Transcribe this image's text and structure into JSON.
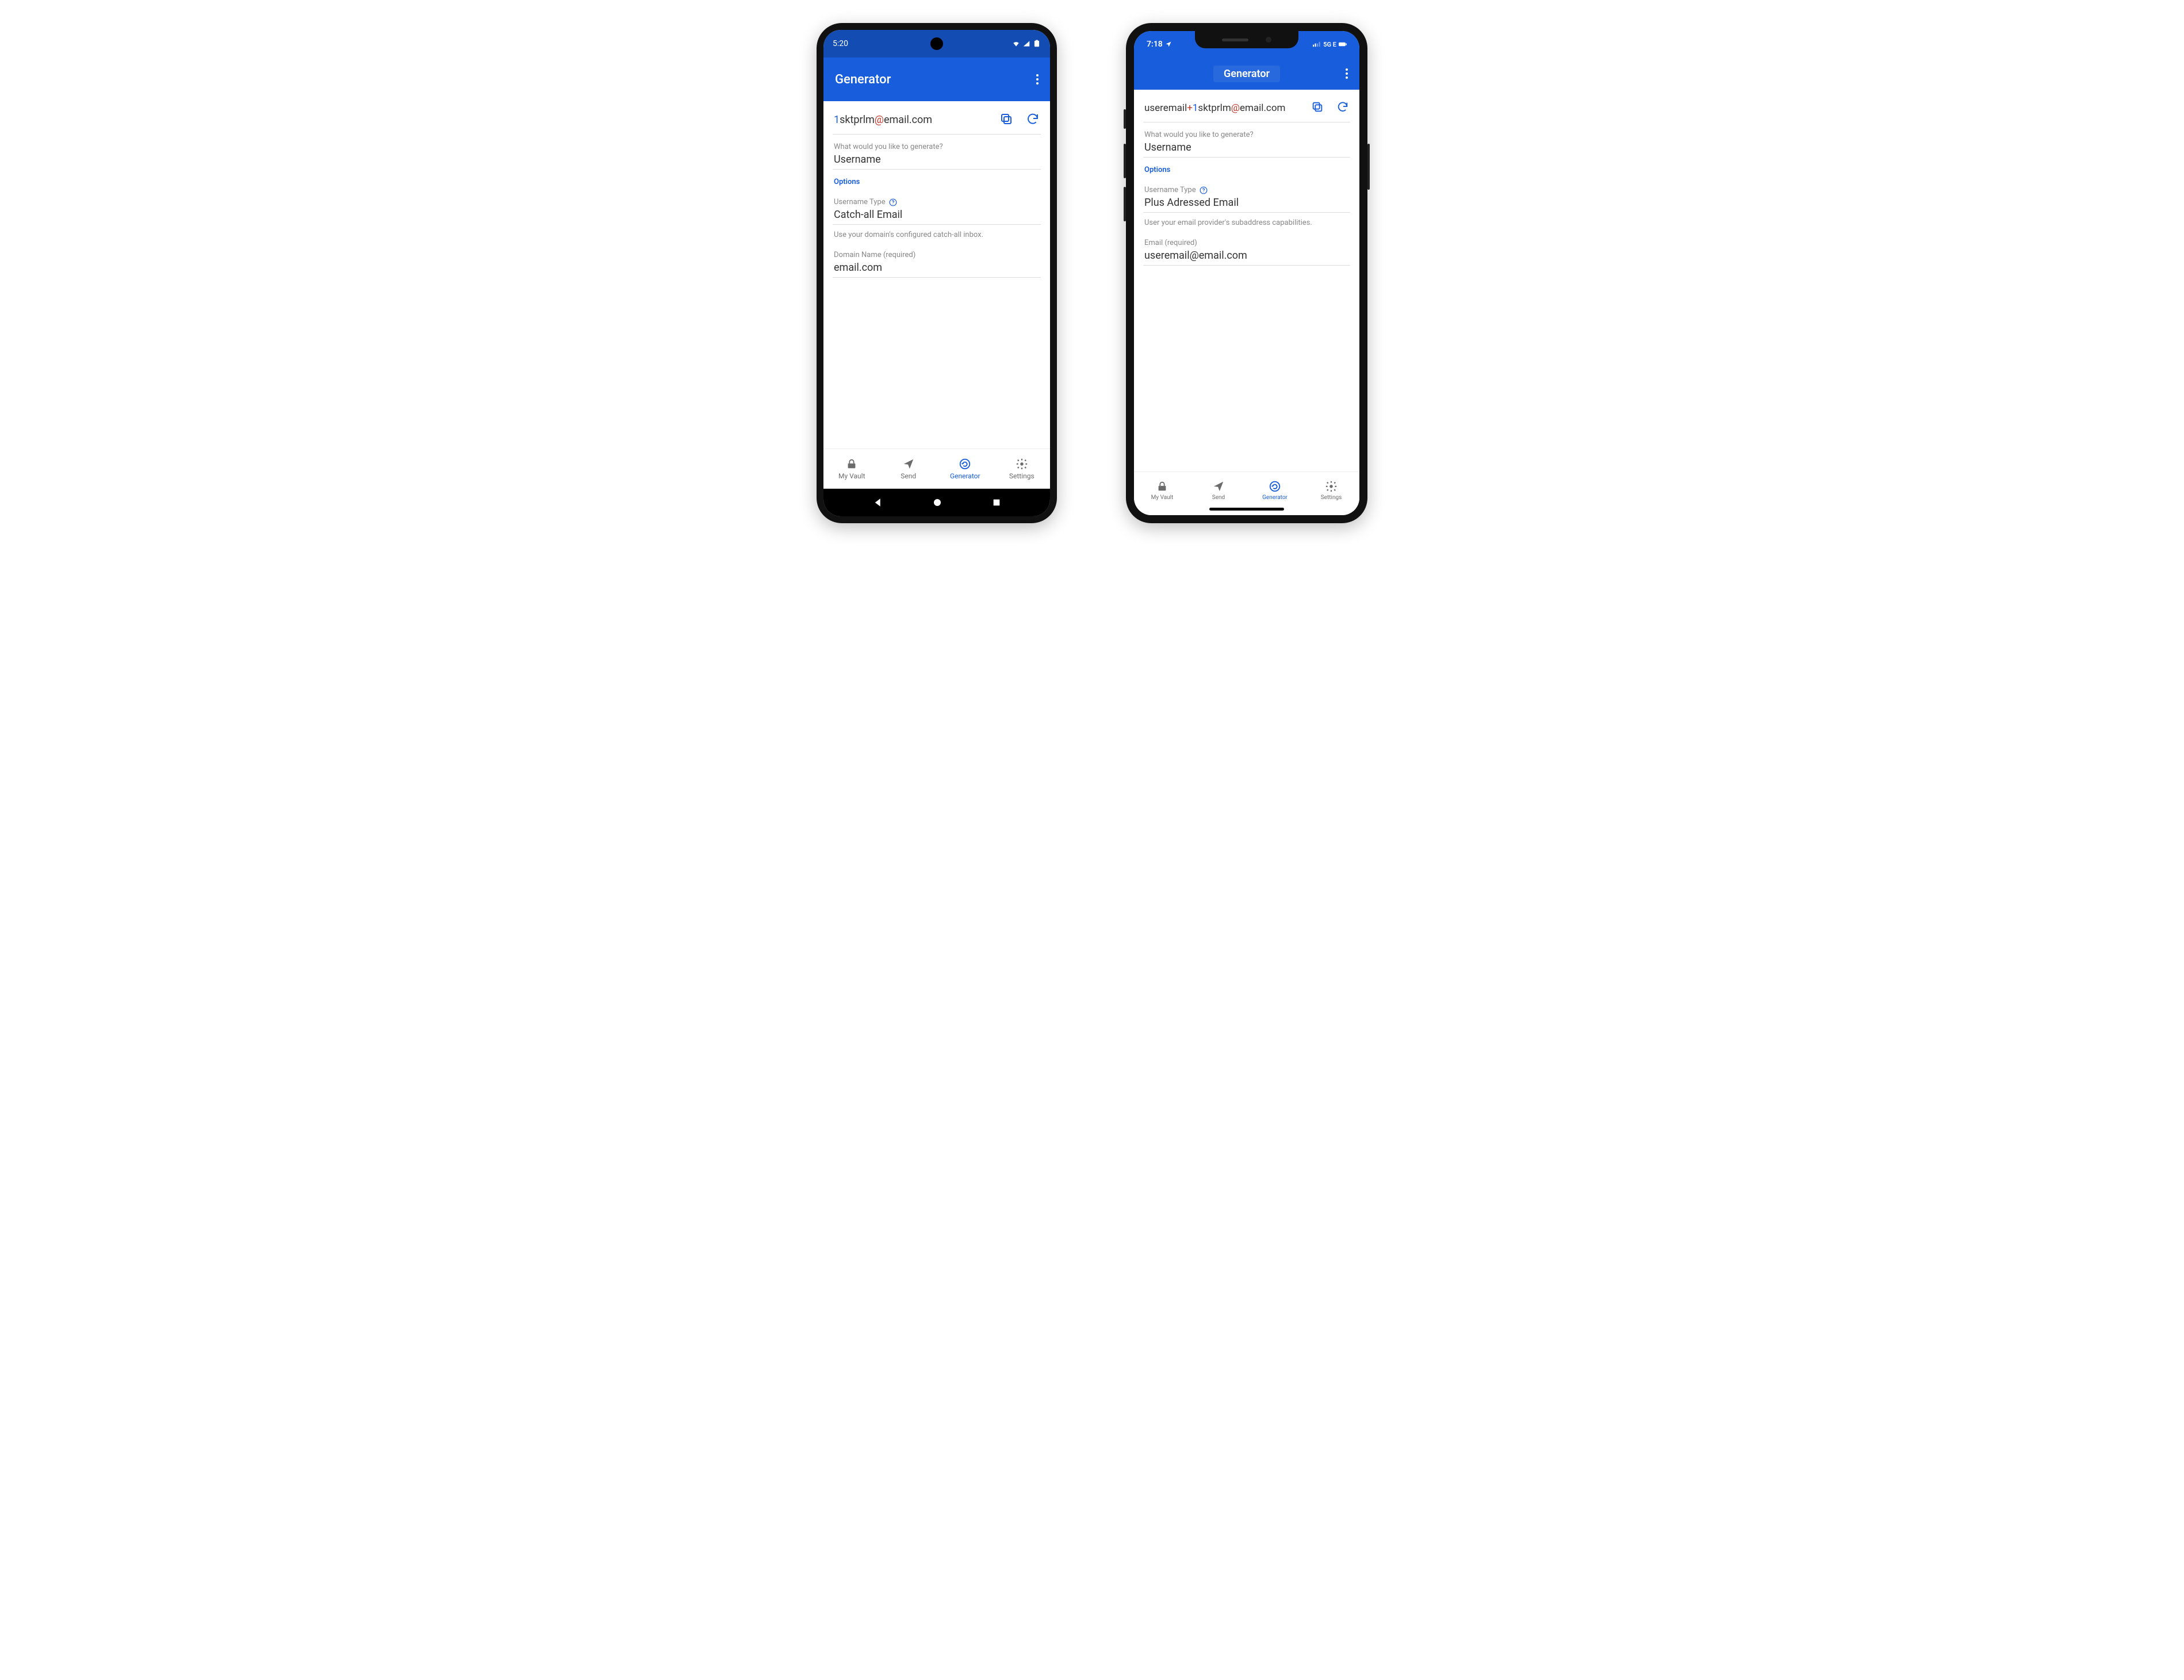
{
  "android": {
    "status": {
      "time": "5:20"
    },
    "appbar_title": "Generator",
    "generated": {
      "prefix_num": "1",
      "mid": "sktprlm",
      "at": "@",
      "suffix": "email.com"
    },
    "q_label": "What would you like to generate?",
    "q_value": "Username",
    "options_label": "Options",
    "utype_label": "Username Type",
    "utype_value": "Catch-all Email",
    "utype_hint": "Use your domain's configured catch-all inbox.",
    "domain_label": "Domain Name (required)",
    "domain_value": "email.com",
    "tabs": [
      "My Vault",
      "Send",
      "Generator",
      "Settings"
    ]
  },
  "ios": {
    "status": {
      "time": "7:18",
      "net": "5G E"
    },
    "appbar_title": "Generator",
    "generated": {
      "p1": "useremail",
      "plus": "+",
      "p2_num": "1",
      "p2": "sktprlm",
      "at": "@",
      "suffix": "email.com"
    },
    "q_label": "What would you like to generate?",
    "q_value": "Username",
    "options_label": "Options",
    "utype_label": "Username Type",
    "utype_value": "Plus Adressed Email",
    "utype_hint": "User your email provider's subaddress capabilities.",
    "email_label": "Email (required)",
    "email_value": "useremail@email.com",
    "tabs": [
      "My Vault",
      "Send",
      "Generator",
      "Settings"
    ]
  }
}
